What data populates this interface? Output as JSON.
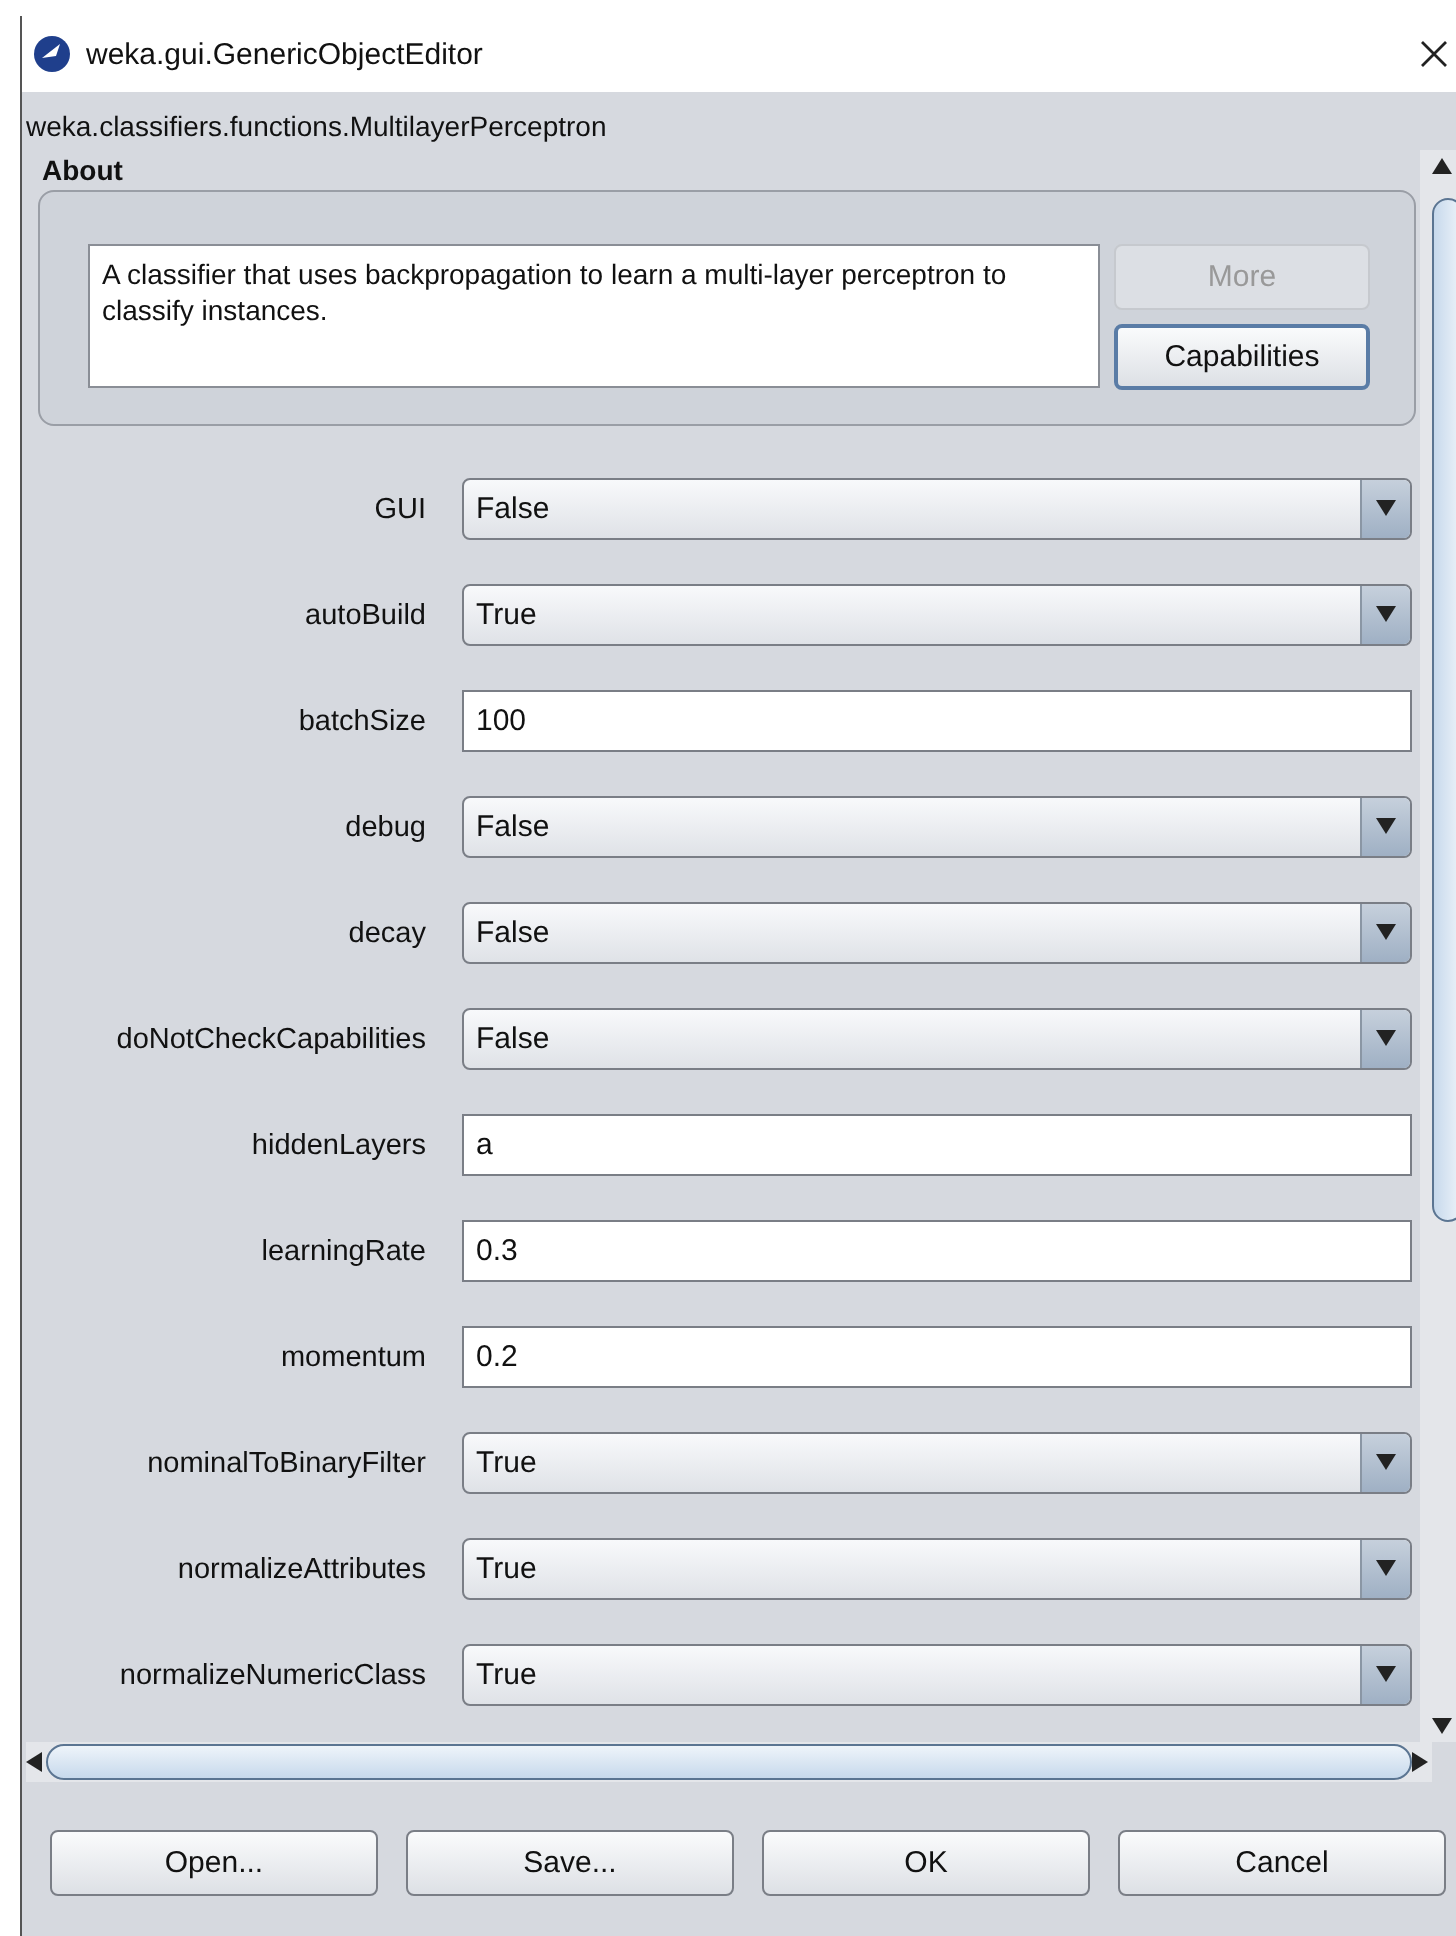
{
  "window": {
    "title": "weka.gui.GenericObjectEditor"
  },
  "class_name": "weka.classifiers.functions.MultilayerPerceptron",
  "about": {
    "heading": "About",
    "description": "A classifier that uses backpropagation to learn a multi-layer perceptron to classify instances.",
    "buttons": [
      {
        "label": "More",
        "disabled": true
      },
      {
        "label": "Capabilities",
        "disabled": false
      }
    ]
  },
  "properties": [
    {
      "name": "GUI",
      "kind": "dropdown",
      "value": "False"
    },
    {
      "name": "autoBuild",
      "kind": "dropdown",
      "value": "True"
    },
    {
      "name": "batchSize",
      "kind": "text",
      "value": "100"
    },
    {
      "name": "debug",
      "kind": "dropdown",
      "value": "False"
    },
    {
      "name": "decay",
      "kind": "dropdown",
      "value": "False"
    },
    {
      "name": "doNotCheckCapabilities",
      "kind": "dropdown",
      "value": "False"
    },
    {
      "name": "hiddenLayers",
      "kind": "text",
      "value": "a"
    },
    {
      "name": "learningRate",
      "kind": "text",
      "value": "0.3"
    },
    {
      "name": "momentum",
      "kind": "text",
      "value": "0.2"
    },
    {
      "name": "nominalToBinaryFilter",
      "kind": "dropdown",
      "value": "True"
    },
    {
      "name": "normalizeAttributes",
      "kind": "dropdown",
      "value": "True"
    },
    {
      "name": "normalizeNumericClass",
      "kind": "dropdown",
      "value": "True"
    }
  ],
  "buttons": [
    "Open...",
    "Save...",
    "OK",
    "Cancel"
  ]
}
